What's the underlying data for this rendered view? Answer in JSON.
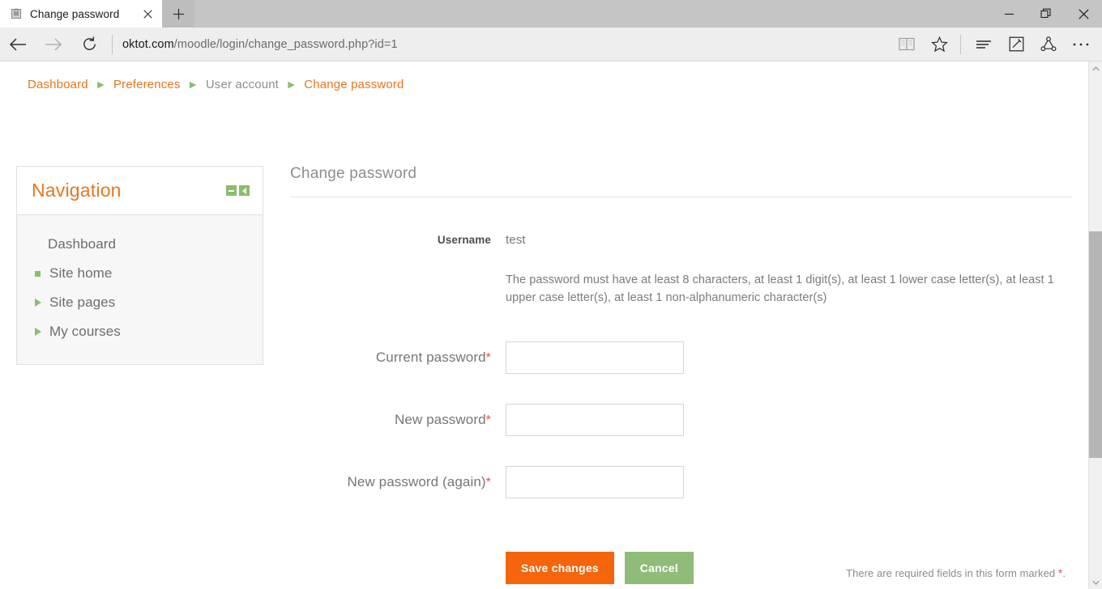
{
  "browser": {
    "tab": {
      "title": "Change password",
      "favicon_icon": "page-favicon",
      "close_icon": "close-icon"
    },
    "new_tab_label": "+",
    "window_controls": {
      "minimize": "─",
      "restore": "❐",
      "close": "✕"
    },
    "nav": {
      "back_icon": "back-arrow-icon",
      "forward_icon": "forward-arrow-icon",
      "refresh_icon": "refresh-icon"
    },
    "url": {
      "host": "oktot.com",
      "path": "/moodle/login/change_password.php?id=1"
    },
    "toolbar_icons": [
      {
        "name": "reading-view-icon"
      },
      {
        "name": "favorites-star-icon"
      },
      {
        "name": "hub-icon"
      },
      {
        "name": "web-note-icon"
      },
      {
        "name": "share-icon"
      },
      {
        "name": "more-settings-icon"
      }
    ]
  },
  "breadcrumb": {
    "separator": "▶",
    "items": [
      {
        "label": "Dashboard",
        "current": false
      },
      {
        "label": "Preferences",
        "current": false
      },
      {
        "label": "User account",
        "current": true
      },
      {
        "label": "Change password",
        "current": false
      }
    ]
  },
  "navigation_block": {
    "title": "Navigation",
    "actions": [
      {
        "name": "collapse-block-icon"
      },
      {
        "name": "dock-block-icon"
      }
    ],
    "items": [
      {
        "label": "Dashboard",
        "bullet": "none"
      },
      {
        "label": "Site home",
        "bullet": "square"
      },
      {
        "label": "Site pages",
        "bullet": "triangle"
      },
      {
        "label": "My courses",
        "bullet": "triangle"
      }
    ]
  },
  "form": {
    "heading": "Change password",
    "username_label": "Username",
    "username_value": "test",
    "policy_text": "The password must have at least 8 characters, at least 1 digit(s), at least 1 lower case letter(s), at least 1 upper case letter(s), at least 1 non-alphanumeric character(s)",
    "required_marker": "*",
    "fields": [
      {
        "label": "Current password",
        "value": "",
        "placeholder": ""
      },
      {
        "label": "New password",
        "value": "",
        "placeholder": ""
      },
      {
        "label": "New password (again)",
        "value": "",
        "placeholder": ""
      }
    ],
    "save_label": "Save changes",
    "cancel_label": "Cancel",
    "footnote": "There are required fields in this form marked",
    "footnote_suffix": "."
  },
  "colors": {
    "accent_orange": "#e8761e",
    "button_orange": "#f4650c",
    "green": "#8bbd6e",
    "cancel_green": "#8fbc78",
    "required_red": "#f14c4c"
  }
}
